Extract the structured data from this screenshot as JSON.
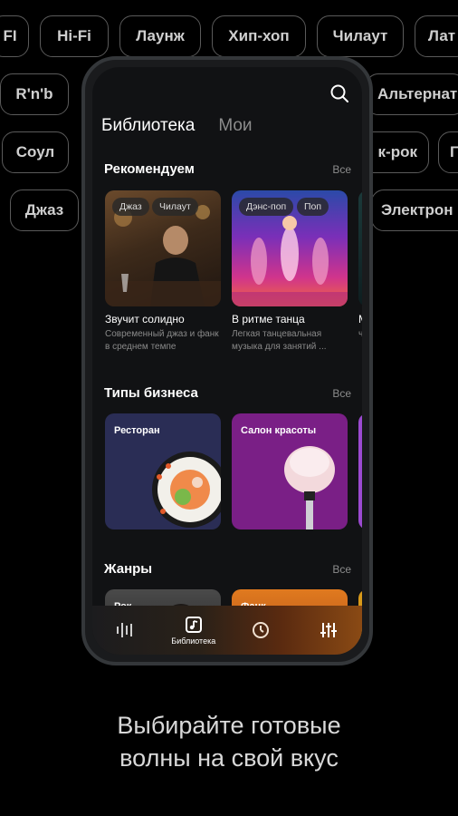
{
  "chips": [
    {
      "label": "FI"
    },
    {
      "label": "Hi-Fi"
    },
    {
      "label": "Лаунж"
    },
    {
      "label": "Хип-хоп"
    },
    {
      "label": "Чилаут"
    },
    {
      "label": "Лат"
    },
    {
      "label": "R'n'b"
    },
    {
      "label": "Альтернат"
    },
    {
      "label": "Соул"
    },
    {
      "label": "к-рок"
    },
    {
      "label": "Г"
    },
    {
      "label": "Джаз"
    },
    {
      "label": "Электрон"
    }
  ],
  "app": {
    "tabs": {
      "library": "Библиотека",
      "mine": "Мои"
    },
    "recommended": {
      "title": "Рекомендуем",
      "see_all": "Все",
      "cards": [
        {
          "title": "Звучит солидно",
          "subtitle": "Современный джаз и фанк в среднем темпе",
          "tags": [
            "Джаз",
            "Чилаут"
          ]
        },
        {
          "title": "В ритме танца",
          "subtitle": "Легкая танцевальная музыка для занятий ...",
          "tags": [
            "Дэнс-поп",
            "Поп"
          ]
        },
        {
          "title": "М",
          "subtitle": "чи"
        }
      ]
    },
    "business": {
      "title": "Типы бизнеса",
      "see_all": "Все",
      "cards": [
        {
          "label": "Ресторан"
        },
        {
          "label": "Салон красоты"
        }
      ]
    },
    "genres": {
      "title": "Жанры",
      "see_all": "Все",
      "cards": [
        {
          "label": "Рок"
        },
        {
          "label": "Фанк"
        }
      ]
    },
    "nav": {
      "library_label": "Библиотека"
    }
  },
  "caption": {
    "line1": "Выбирайте готовые",
    "line2": "волны на свой вкус"
  },
  "colors": {
    "accent_orange": "#e07a1f",
    "purple": "#7a1f86",
    "navy": "#2a2d55"
  }
}
